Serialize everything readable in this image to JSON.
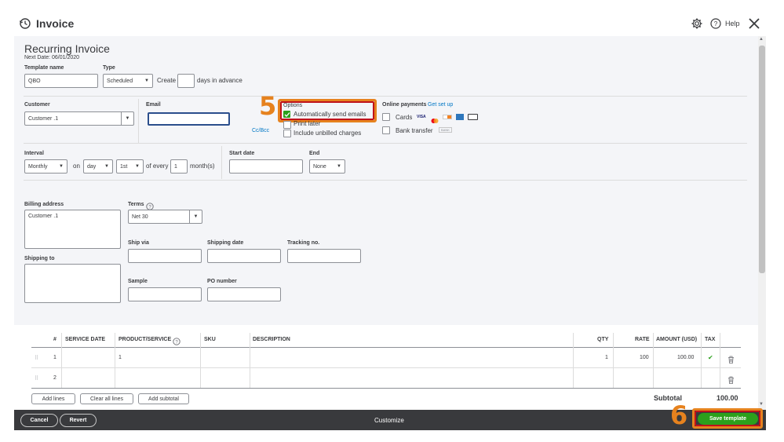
{
  "header": {
    "title": "Invoice",
    "help_label": "Help"
  },
  "recurring": {
    "title": "Recurring Invoice",
    "next_date": "Next Date: 06/01/2020",
    "template_name_label": "Template name",
    "template_name_value": "QBO",
    "type_label": "Type",
    "type_value": "Scheduled",
    "create_label": "Create",
    "create_days_value": "",
    "days_in_advance_label": "days in advance"
  },
  "customer": {
    "customer_label": "Customer",
    "customer_value": "Customer .1",
    "email_label": "Email",
    "email_value": "",
    "cc_bcc_label": "Cc/Bcc"
  },
  "options": {
    "label": "Options",
    "auto_send": "Automatically send emails",
    "auto_send_checked": true,
    "print_later": "Print later",
    "include_unbilled": "Include unbilled charges"
  },
  "online_payments": {
    "label": "Online payments",
    "get_set_up": "Get set up",
    "cards": "Cards",
    "bank_transfer": "Bank transfer",
    "card_brands": [
      "VISA",
      "MC",
      "DISC",
      "AMEX",
      "PAY"
    ],
    "bank_badge": "BANK"
  },
  "schedule": {
    "interval_label": "Interval",
    "interval_value": "Monthly",
    "on_label": "on",
    "day_value": "day",
    "nth_value": "1st",
    "of_every_label": "of every",
    "every_value": "1",
    "months_label": "month(s)",
    "start_date_label": "Start date",
    "start_date_value": "",
    "end_label": "End",
    "end_value": "None"
  },
  "billing": {
    "billing_address_label": "Billing address",
    "billing_address_value": "Customer .1",
    "shipping_to_label": "Shipping to",
    "terms_label": "Terms",
    "terms_value": "Net 30",
    "ship_via_label": "Ship via",
    "shipping_date_label": "Shipping date",
    "tracking_label": "Tracking no.",
    "sample_label": "Sample",
    "po_number_label": "PO number"
  },
  "table": {
    "headers": {
      "num": "#",
      "service_date": "SERVICE DATE",
      "product": "PRODUCT/SERVICE",
      "sku": "SKU",
      "description": "DESCRIPTION",
      "qty": "QTY",
      "rate": "RATE",
      "amount": "AMOUNT (USD)",
      "tax": "TAX"
    },
    "rows": [
      {
        "num": "1",
        "service_date": "",
        "product": "1",
        "sku": "",
        "description": "",
        "qty": "1",
        "rate": "100",
        "amount": "100.00",
        "tax": "✔"
      },
      {
        "num": "2",
        "service_date": "",
        "product": "",
        "sku": "",
        "description": "",
        "qty": "",
        "rate": "",
        "amount": "",
        "tax": ""
      }
    ],
    "add_lines": "Add lines",
    "clear_all_lines": "Clear all lines",
    "add_subtotal": "Add subtotal",
    "subtotal_label": "Subtotal",
    "subtotal_value": "100.00"
  },
  "footer": {
    "cancel": "Cancel",
    "revert": "Revert",
    "customize": "Customize",
    "save_template": "Save template"
  },
  "markers": {
    "step5": "5",
    "step6": "6"
  },
  "colors": {
    "highlight": "#e6821e",
    "highlight_inner": "#c0121a",
    "green": "#2ca01c",
    "link": "#0077c5",
    "footer_bg": "#393a3d"
  }
}
